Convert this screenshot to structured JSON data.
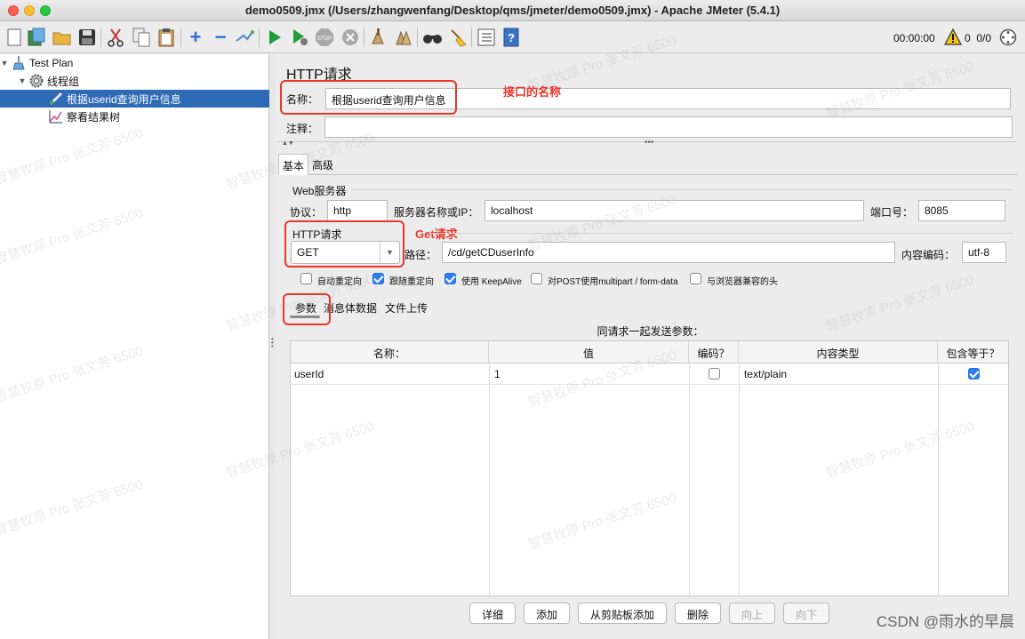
{
  "window": {
    "title": "demo0509.jmx (/Users/zhangwenfang/Desktop/qms/jmeter/demo0509.jmx) - Apache JMeter (5.4.1)"
  },
  "toolbar": {
    "elapsed_time": "00:00:00",
    "error_count": "0",
    "thread_count": "0/0",
    "icons": [
      "new-icon",
      "templates-icon",
      "open-icon",
      "save-icon",
      "cut-icon",
      "copy-icon",
      "paste-icon",
      "expand-icon",
      "collapse-icon",
      "toggle-icon",
      "start-icon",
      "start-no-pause-icon",
      "stop-icon",
      "shutdown-icon",
      "clear-icon",
      "clear-all-icon",
      "search-icon",
      "reset-search-icon",
      "function-helper-icon",
      "help-icon"
    ]
  },
  "tree": {
    "items": [
      {
        "label": "Test Plan",
        "icon": "test-plan-icon"
      },
      {
        "label": "线程组",
        "icon": "gear-icon"
      },
      {
        "label": "根据userid查询用户信息",
        "icon": "pen-icon"
      },
      {
        "label": "察看结果树",
        "icon": "chart-icon"
      }
    ]
  },
  "panel": {
    "title": "HTTP请求",
    "name_label": "名称：",
    "name_value": "根据userid查询用户信息",
    "comment_label": "注释：",
    "comment_value": "",
    "annotations": {
      "name_note": "接口的名称",
      "method_note": "Get请求"
    },
    "tabs": [
      "基本",
      "高级"
    ],
    "web_server": {
      "group_label": "Web服务器",
      "protocol_label": "协议：",
      "protocol_value": "http",
      "server_label": "服务器名称或IP：",
      "server_value": "localhost",
      "port_label": "端口号：",
      "port_value": "8085"
    },
    "http_request": {
      "group_label": "HTTP请求",
      "method": "GET",
      "path_label": "路径：",
      "path_value": "/cd/getCDuserInfo",
      "encoding_label": "内容编码：",
      "encoding_value": "utf-8"
    },
    "options": [
      {
        "label": "自动重定向",
        "checked": false
      },
      {
        "label": "跟随重定向",
        "checked": true
      },
      {
        "label": "使用 KeepAlive",
        "checked": true
      },
      {
        "label": "对POST使用multipart / form-data",
        "checked": false
      },
      {
        "label": "与浏览器兼容的头",
        "checked": false
      }
    ],
    "param_tabs": [
      "参数",
      "消息体数据",
      "文件上传"
    ],
    "params": {
      "title": "同请求一起发送参数：",
      "headers": [
        "名称：",
        "值",
        "编码？",
        "内容类型",
        "包含等于？"
      ],
      "rows": [
        {
          "name": "userId",
          "value": "1",
          "encode": false,
          "content_type": "text/plain",
          "include_equals": true
        }
      ]
    },
    "buttons": [
      {
        "label": "详细",
        "enabled": true
      },
      {
        "label": "添加",
        "enabled": true
      },
      {
        "label": "从剪贴板添加",
        "enabled": true
      },
      {
        "label": "删除",
        "enabled": true
      },
      {
        "label": "向上",
        "enabled": false
      },
      {
        "label": "向下",
        "enabled": false
      }
    ]
  },
  "watermark": {
    "csdn": "CSDN @雨水的早晨",
    "tiled": "智慧牧原 Pro 张文芳 6500"
  }
}
